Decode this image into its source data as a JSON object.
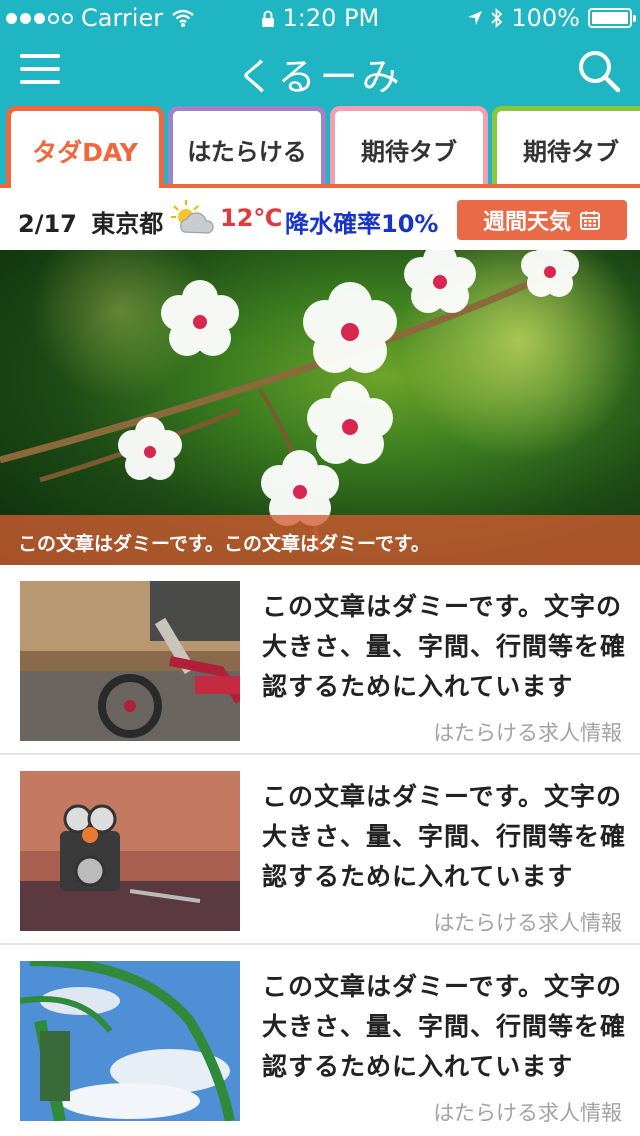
{
  "status_bar": {
    "carrier": "Carrier",
    "time": "1:20 PM",
    "battery": "100%",
    "battery_level": 1.0
  },
  "header": {
    "title": "くるーみ",
    "menu_icon": "hamburger-menu-icon",
    "search_icon": "search-icon",
    "background": "#1fb5c2"
  },
  "tabs": [
    {
      "label": "タダDAY",
      "color": "#f0673b",
      "active": true
    },
    {
      "label": "はたらける",
      "color": "#a084c9",
      "active": false
    },
    {
      "label": "期待タブ",
      "color": "#f2a0b1",
      "active": false
    },
    {
      "label": "期待タブ",
      "color": "#8cc63f",
      "active": false
    }
  ],
  "weather": {
    "date": "2/17",
    "city": "東京都",
    "icon": "partly-cloudy-icon",
    "temperature": "12℃",
    "rain_prob": "降水確率10%",
    "weekly_button": "週間天気",
    "weekly_icon": "calendar-icon"
  },
  "hero": {
    "caption": "この文章はダミーです。この文章はダミーです。",
    "image": "cherry-blossom-photo"
  },
  "articles": [
    {
      "title": "この文章はダミーです。文字の大きさ、量、字間、行間等を確認するために入れています",
      "source": "はたらける求人情報",
      "image": "tricycle-photo"
    },
    {
      "title": "この文章はダミーです。文字の大きさ、量、字間、行間等を確認するために入れています",
      "source": "はたらける求人情報",
      "image": "robot-toy-photo"
    },
    {
      "title": "この文章はダミーです。文字の大きさ、量、字間、行間等を確認するために入れています",
      "source": "はたらける求人情報",
      "image": "roller-coaster-photo"
    }
  ]
}
